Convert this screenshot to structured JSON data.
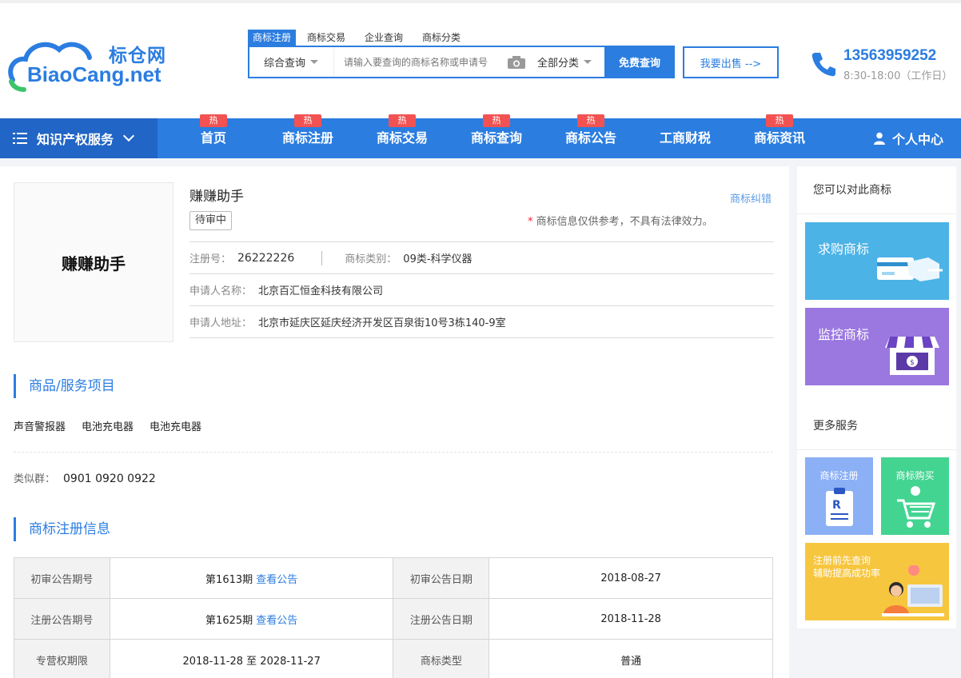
{
  "header": {
    "logo_cn": "标仓网",
    "logo_en": "BiaoCang.net",
    "search_tabs": [
      "商标注册",
      "商标交易",
      "企业查询",
      "商标分类"
    ],
    "search_mode": "综合查询",
    "search_placeholder": "请输入要查询的商标名称或申请号",
    "search_category": "全部分类",
    "search_button": "免费查询",
    "sell_button": "我要出售 -->",
    "phone": "13563959252",
    "hours": "8:30-18:00（工作日）"
  },
  "nav": {
    "category_label": "知识产权服务",
    "hot_label": "热",
    "items": [
      {
        "label": "首页",
        "hot": true
      },
      {
        "label": "商标注册",
        "hot": true
      },
      {
        "label": "商标交易",
        "hot": true
      },
      {
        "label": "商标查询",
        "hot": true
      },
      {
        "label": "商标公告",
        "hot": true
      },
      {
        "label": "工商财税",
        "hot": false
      },
      {
        "label": "商标资讯",
        "hot": true
      }
    ],
    "user_center": "个人中心"
  },
  "trademark": {
    "image_text": "赚赚助手",
    "name": "赚赚助手",
    "status": "待审中",
    "error_link": "商标纠错",
    "notice_star": "*",
    "notice": " 商标信息仅供参考，不具有法律效力。",
    "reg_no_label": "注册号：",
    "reg_no": "26222226",
    "class_label": "商标类别：",
    "class": "09类-科学仪器",
    "applicant_label": "申请人名称：",
    "applicant": "北京百汇恒金科技有限公司",
    "address_label": "申请人地址：",
    "address": "北京市延庆区延庆经济开发区百泉街10号3栋140-9室"
  },
  "goods": {
    "title": "商品/服务项目",
    "items": [
      "声音警报器",
      "电池充电器",
      "电池充电器"
    ],
    "similar_label": "类似群：",
    "similar": "0901 0920 0922"
  },
  "registration": {
    "title": "商标注册信息",
    "rows": [
      {
        "h1": "初审公告期号",
        "v1": "第1613期",
        "link1": "查看公告",
        "h2": "初审公告日期",
        "v2": "2018-08-27"
      },
      {
        "h1": "注册公告期号",
        "v1": "第1625期",
        "link1": "查看公告",
        "h2": "注册公告日期",
        "v2": "2018-11-28"
      },
      {
        "h1": "专营权期限",
        "v1": "2018-11-28 至 2028-11-27",
        "link1": "",
        "h2": "商标类型",
        "v2": "普通"
      }
    ]
  },
  "sidebar": {
    "compare_title": "您可以对此商标",
    "buy_card": "求购商标",
    "monitor_card": "监控商标",
    "more_title": "更多服务",
    "reg_mini": "商标注册",
    "buy_mini": "商标购买",
    "promo_line1": "注册前先查询",
    "promo_line2": "辅助提高成功率"
  },
  "colors": {
    "brand": "#2b7de0",
    "hot": "#f25252",
    "buy_card": "#4cb3e6",
    "monitor_card": "#9b78e0",
    "reg_mini": "#8bb0f5",
    "buy_mini": "#43d492",
    "promo": "#f7c63f"
  }
}
